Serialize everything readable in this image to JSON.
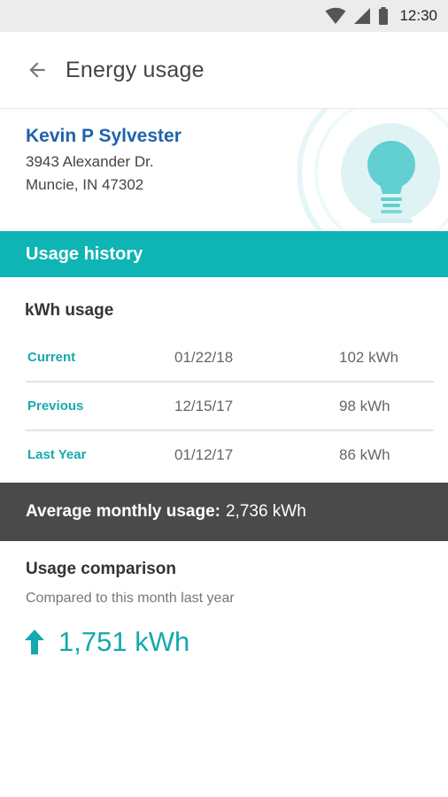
{
  "status_bar": {
    "time": "12:30"
  },
  "app_bar": {
    "title": "Energy usage"
  },
  "account": {
    "name": "Kevin P Sylvester",
    "address_line1": "3943 Alexander Dr.",
    "address_line2": "Muncie, IN 47302"
  },
  "usage_history": {
    "header": "Usage history",
    "kwh_title": "kWh usage",
    "rows": [
      {
        "label": "Current",
        "date": "01/22/18",
        "value": "102 kWh"
      },
      {
        "label": "Previous",
        "date": "12/15/17",
        "value": "98 kWh"
      },
      {
        "label": "Last Year",
        "date": "01/12/17",
        "value": "86 kWh"
      }
    ]
  },
  "average": {
    "label": "Average monthly usage:",
    "value": "2,736 kWh"
  },
  "comparison": {
    "title": "Usage comparison",
    "subtitle": "Compared to this month last year",
    "value": "1,751 kWh",
    "direction_icon": "arrow-up-icon"
  },
  "colors": {
    "accent": "#0fb4b5",
    "name_blue": "#1f63a8",
    "dark_bar": "#4a4a4a"
  }
}
